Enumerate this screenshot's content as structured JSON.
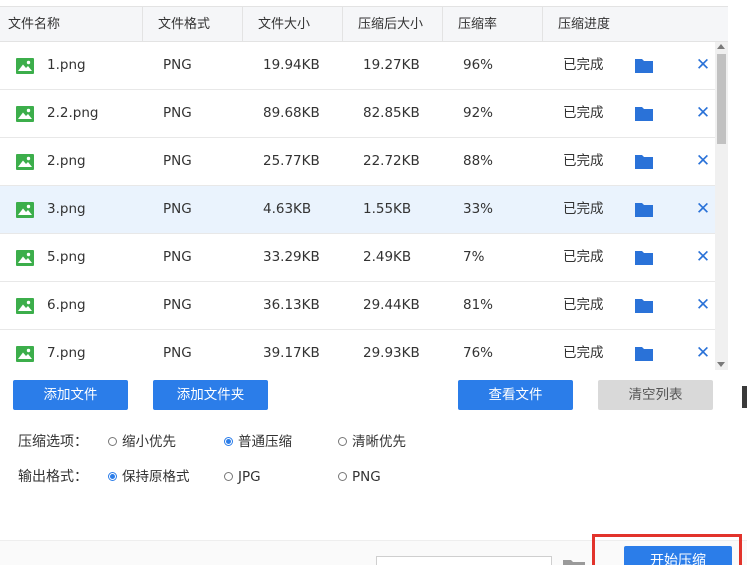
{
  "table": {
    "headers": [
      "文件名称",
      "文件格式",
      "文件大小",
      "压缩后大小",
      "压缩率",
      "压缩进度"
    ],
    "rows": [
      {
        "name": "1.png",
        "format": "PNG",
        "size": "19.94KB",
        "compressed": "19.27KB",
        "ratio": "96%",
        "status": "已完成",
        "selected": false
      },
      {
        "name": "2.2.png",
        "format": "PNG",
        "size": "89.68KB",
        "compressed": "82.85KB",
        "ratio": "92%",
        "status": "已完成",
        "selected": false
      },
      {
        "name": "2.png",
        "format": "PNG",
        "size": "25.77KB",
        "compressed": "22.72KB",
        "ratio": "88%",
        "status": "已完成",
        "selected": false
      },
      {
        "name": "3.png",
        "format": "PNG",
        "size": "4.63KB",
        "compressed": "1.55KB",
        "ratio": "33%",
        "status": "已完成",
        "selected": true
      },
      {
        "name": "5.png",
        "format": "PNG",
        "size": "33.29KB",
        "compressed": "2.49KB",
        "ratio": "7%",
        "status": "已完成",
        "selected": false
      },
      {
        "name": "6.png",
        "format": "PNG",
        "size": "36.13KB",
        "compressed": "29.44KB",
        "ratio": "81%",
        "status": "已完成",
        "selected": false
      },
      {
        "name": "7.png",
        "format": "PNG",
        "size": "39.17KB",
        "compressed": "29.93KB",
        "ratio": "76%",
        "status": "已完成",
        "selected": false
      }
    ],
    "delete_symbol": "✕"
  },
  "buttons": {
    "add_file": "添加文件",
    "add_folder": "添加文件夹",
    "view_files": "查看文件",
    "clear_list": "清空列表",
    "start": "开始压缩"
  },
  "options": {
    "compress_label": "压缩选项：",
    "compress": [
      {
        "label": "缩小优先",
        "checked": false
      },
      {
        "label": "普通压缩",
        "checked": true
      },
      {
        "label": "清晰优先",
        "checked": false
      }
    ],
    "output_label": "输出格式：",
    "output": [
      {
        "label": "保持原格式",
        "checked": true
      },
      {
        "label": "JPG",
        "checked": false
      },
      {
        "label": "PNG",
        "checked": false
      }
    ]
  },
  "colors": {
    "accent": "#2b7de9",
    "icon_green": "#3cae4b",
    "close_blue": "#2a72d8",
    "selected_row": "#eaf3fd",
    "highlight_red": "#e2332b"
  },
  "icons": {
    "file": "image-file-icon",
    "folder": "folder-icon",
    "delete": "close-icon"
  }
}
